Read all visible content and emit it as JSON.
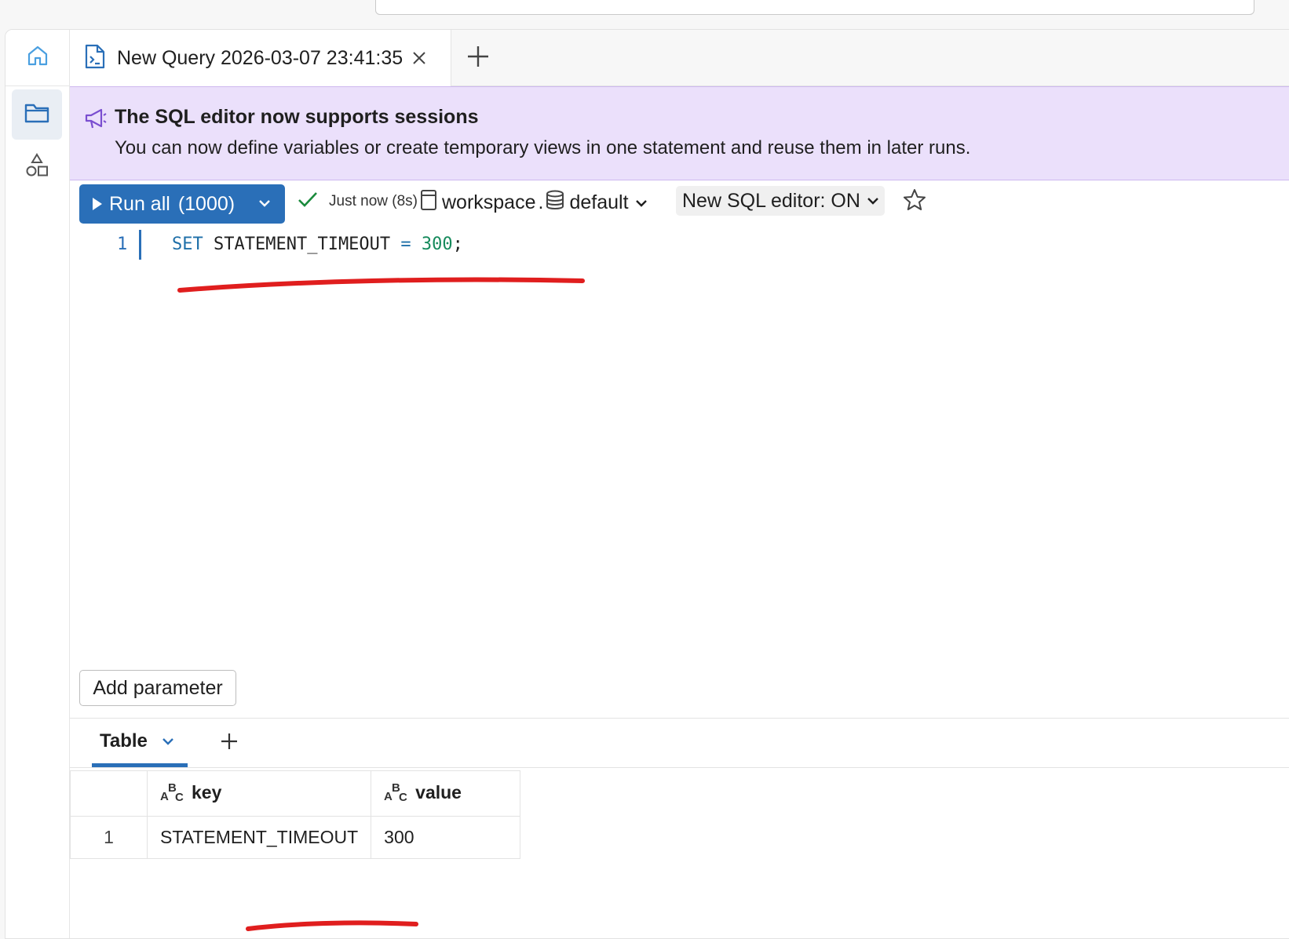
{
  "tabs": [
    {
      "title": "New Query 2026-03-07 23:41:35"
    }
  ],
  "banner": {
    "title": "The SQL editor now supports sessions",
    "body": "You can now define variables or create temporary views in one statement and reuse them in later runs."
  },
  "toolbar": {
    "run_label": "Run all",
    "run_count": "(1000)",
    "status_text": "Just now (8s)",
    "catalog": "workspace",
    "schema": "default",
    "editor_toggle": "New SQL editor: ON"
  },
  "editor": {
    "line_number": "1",
    "code": {
      "keyword": "SET",
      "identifier": "STATEMENT_TIMEOUT",
      "operator": "=",
      "value": "300",
      "terminator": ";"
    }
  },
  "add_parameter_label": "Add parameter",
  "results": {
    "tab_label": "Table",
    "columns": [
      "key",
      "value"
    ],
    "rows": [
      {
        "index": "1",
        "key": "STATEMENT_TIMEOUT",
        "value": "300"
      }
    ]
  },
  "colors": {
    "accent": "#2a6fb8",
    "banner_bg": "#ebe0fb",
    "success": "#1a8a3c",
    "annotation": "#e01e1e"
  }
}
